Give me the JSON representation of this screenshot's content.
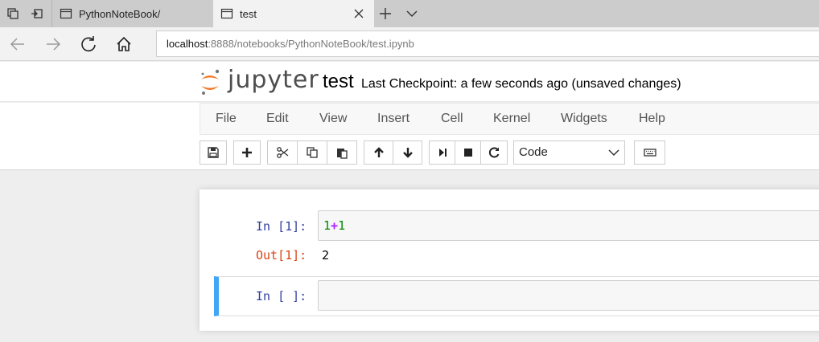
{
  "browser": {
    "tabs": [
      {
        "label": "PythonNoteBook/",
        "active": false
      },
      {
        "label": "test",
        "active": true
      }
    ],
    "url_host": "localhost",
    "url_rest": ":8888/notebooks/PythonNoteBook/test.ipynb"
  },
  "header": {
    "logo_text": "jupyter",
    "notebook_name": "test",
    "checkpoint": "Last Checkpoint: a few seconds ago (unsaved changes)"
  },
  "menu": {
    "items": [
      "File",
      "Edit",
      "View",
      "Insert",
      "Cell",
      "Kernel",
      "Widgets",
      "Help"
    ]
  },
  "toolbar": {
    "cell_type": "Code"
  },
  "cells": [
    {
      "in_prompt": "In [1]:",
      "code_a": "1",
      "code_op": "+",
      "code_b": "1",
      "out_prompt": "Out[1]:",
      "output": "2"
    },
    {
      "in_prompt": "In [ ]:",
      "code": ""
    }
  ],
  "colors": {
    "in_prompt": "#303f9f",
    "out_prompt": "#d84315",
    "selected_bar": "#42a5f5",
    "logo_orange": "#f37726"
  }
}
